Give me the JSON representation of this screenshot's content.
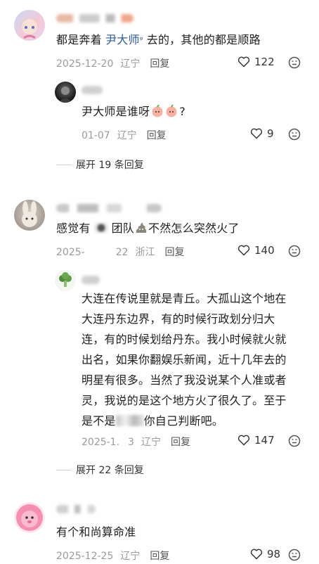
{
  "comments": [
    {
      "text_before": "都是奔着 ",
      "text_link": "尹大师",
      "text_after": " 去的，其他的都是顺路",
      "date": "2025-12-20",
      "location": "辽宁",
      "reply": "回复",
      "likes": "122",
      "replies": [
        {
          "text_main": "尹大师是谁呀",
          "text_end": "?",
          "date": "01-07",
          "location": "辽宁",
          "reply": "回复",
          "likes": "9"
        }
      ],
      "expand": "展开 19 条回复"
    },
    {
      "text_a": "感觉有",
      "text_b": "团队",
      "text_c": "不然怎么突然火了",
      "date_visible": "2025-",
      "date_tail": "22",
      "location": "浙江",
      "reply": "回复",
      "likes": "140",
      "replies": [
        {
          "line1": "大连在传说里就是青丘。大孤山这个地在",
          "line2": "大连丹东边界，有的时候行政划分归大",
          "line3": "连，有的时候划给丹东。我小时候就火就",
          "line4": "出名，如果你翻娱乐新闻，近十几年去的",
          "line5": "明星有很多。当然了我没说某个人准或者",
          "line6": "灵，我说的是这个地方火了很久了。至于",
          "line7a": "是不是",
          "line7b": "你自己判断吧。",
          "date_head": "2025-1.",
          "date_tail": "3",
          "location": "辽宁",
          "reply": "回复",
          "likes": "147"
        }
      ],
      "expand": "展开 22 条回复"
    },
    {
      "text": "有个和尚算命准",
      "date": "2025-12-25",
      "location": "辽宁",
      "reply": "回复",
      "likes": "98"
    }
  ],
  "colors": {
    "link": "#2f5d9a",
    "meta": "#9a9a9a"
  }
}
